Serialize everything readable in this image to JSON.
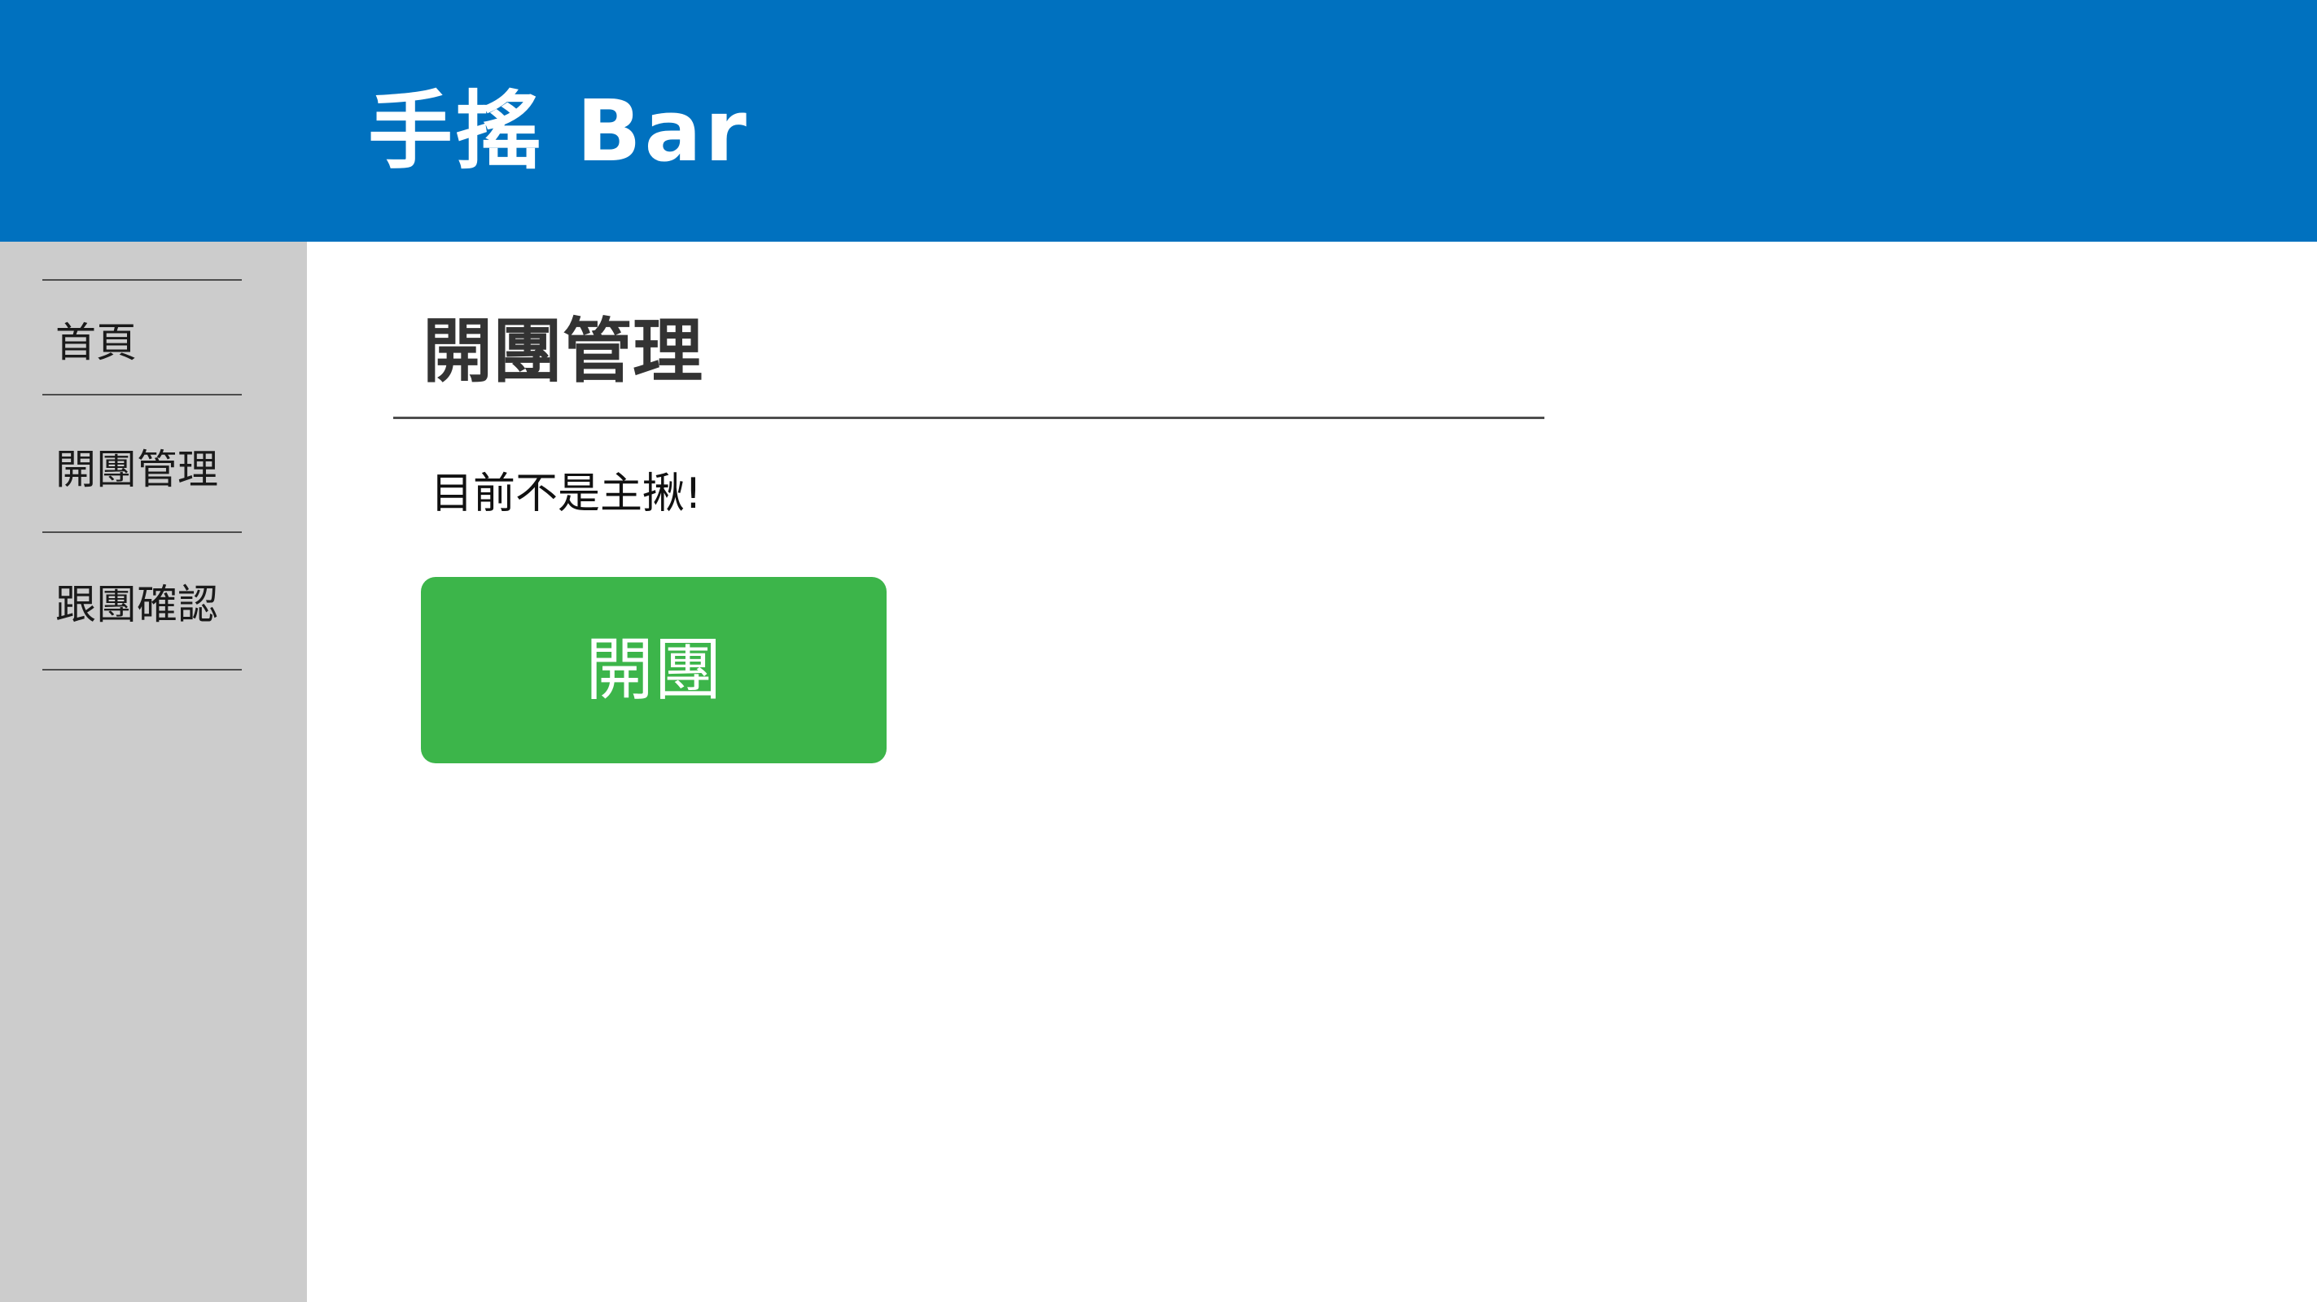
{
  "header": {
    "app_title": "手搖 Bar",
    "background_color": "#0071bf"
  },
  "sidebar": {
    "background_color": "#cccccc",
    "items": [
      {
        "label": "首頁"
      },
      {
        "label": "開團管理"
      },
      {
        "label": "跟團確認"
      }
    ]
  },
  "main": {
    "page_title": "開團管理",
    "status_text": "目前不是主揪!",
    "open_group_button": {
      "label": "開團",
      "color": "#3cb54a"
    }
  }
}
